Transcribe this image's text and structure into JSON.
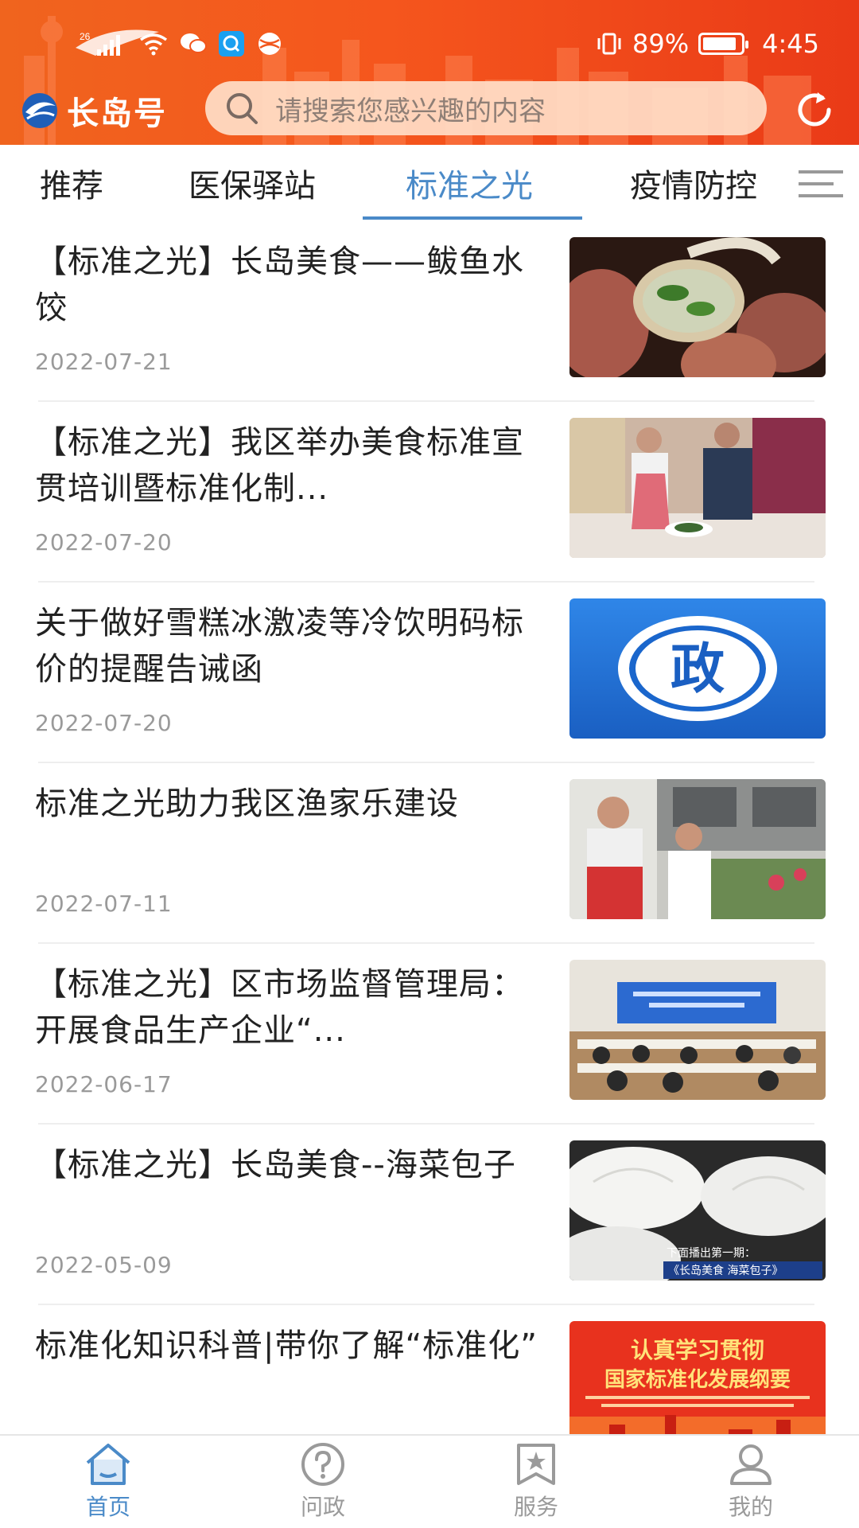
{
  "status_bar": {
    "network_badge": "26",
    "battery_percent": "89%",
    "battery_level": 0.89,
    "time": "4:45"
  },
  "header": {
    "app_name": "长岛号",
    "search_placeholder": "请搜索您感兴趣的内容",
    "brand_color": "#f2561d"
  },
  "tabs": [
    {
      "label": "推荐",
      "active": false
    },
    {
      "label": "医保驿站",
      "active": false
    },
    {
      "label": "标准之光",
      "active": true
    },
    {
      "label": "疫情防控",
      "active": false
    }
  ],
  "accent_color": "#4a8ac8",
  "news": [
    {
      "title": "【标准之光】长岛美食——鲅鱼水饺",
      "date": "2022-07-21",
      "thumb": "dumpling-photo"
    },
    {
      "title": "【标准之光】我区举办美食标准宣贯培训暨标准化制...",
      "date": "2022-07-20",
      "thumb": "cooking-training-photo"
    },
    {
      "title": "关于做好雪糕冰激凌等冷饮明码标价的提醒告诫函",
      "date": "2022-07-20",
      "thumb": "zheng-logo"
    },
    {
      "title": "标准之光助力我区渔家乐建设",
      "date": "2022-07-11",
      "thumb": "interview-photo"
    },
    {
      "title": "【标准之光】区市场监督管理局：开展食品生产企业“...",
      "date": "2022-06-17",
      "thumb": "meeting-room-photo"
    },
    {
      "title": "【标准之光】长岛美食--海菜包子",
      "date": "2022-05-09",
      "thumb": "steamed-buns-photo"
    },
    {
      "title": "标准化知识科普|带你了解“标准化”",
      "date": "",
      "thumb": "standardization-poster"
    }
  ],
  "thumb_captions": {
    "buns_caption_top": "下面播出第一期：",
    "buns_caption_bottom": "《长岛美食 海菜包子》",
    "zheng_char": "政",
    "poster_line1": "认真学习贯彻",
    "poster_line2": "国家标准化发展纲要"
  },
  "bottom_nav": [
    {
      "label": "首页",
      "icon": "home-icon",
      "active": true
    },
    {
      "label": "问政",
      "icon": "question-icon",
      "active": false
    },
    {
      "label": "服务",
      "icon": "star-bookmark-icon",
      "active": false
    },
    {
      "label": "我的",
      "icon": "user-icon",
      "active": false
    }
  ]
}
